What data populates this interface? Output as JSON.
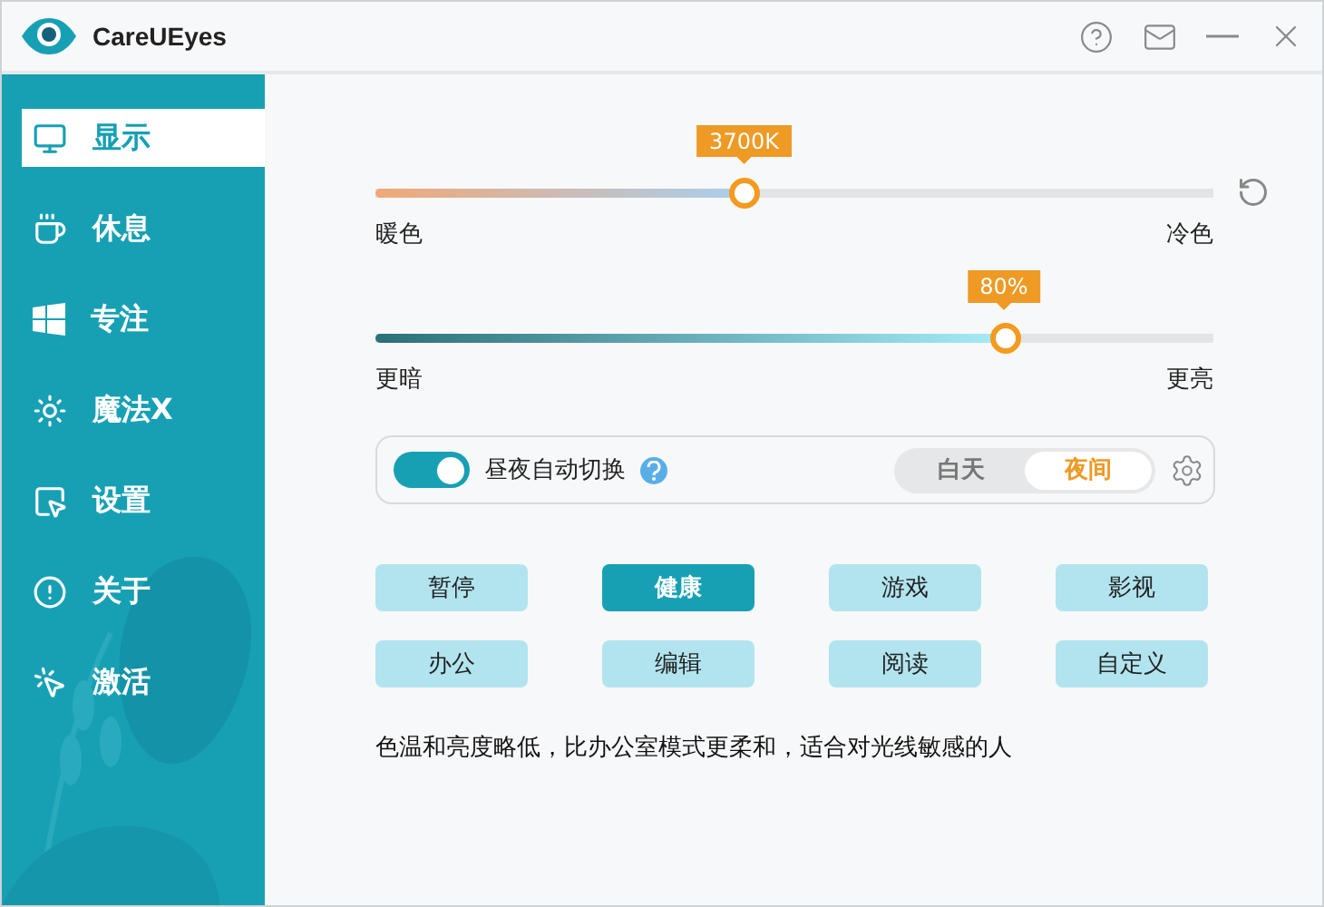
{
  "window": {
    "title": "CareUEyes"
  },
  "sidebar": {
    "items": [
      {
        "label": "显示",
        "kind": "monitor",
        "selected": true
      },
      {
        "label": "休息",
        "kind": "cup",
        "selected": false
      },
      {
        "label": "专注",
        "kind": "windows",
        "selected": false
      },
      {
        "label": "魔法X",
        "kind": "sun",
        "selected": false
      },
      {
        "label": "设置",
        "kind": "pointer",
        "selected": false
      },
      {
        "label": "关于",
        "kind": "alert",
        "selected": false
      },
      {
        "label": "激活",
        "kind": "click",
        "selected": false
      }
    ]
  },
  "sliders": [
    {
      "kind": "temperature",
      "level": 0.44,
      "reading": "3700K",
      "min_label": "暖色",
      "max_label": "冷色"
    },
    {
      "kind": "brightness",
      "level": 0.75,
      "reading": "80%",
      "min_label": "更暗",
      "max_label": "更亮"
    }
  ],
  "auto_switch": {
    "label": "昼夜自动切换",
    "on": true,
    "modes": [
      {
        "label": "白天",
        "selected": false
      },
      {
        "label": "夜间",
        "selected": true
      }
    ]
  },
  "presets": [
    {
      "label": "暂停",
      "selected": false
    },
    {
      "label": "健康",
      "selected": true
    },
    {
      "label": "游戏",
      "selected": false
    },
    {
      "label": "影视",
      "selected": false
    },
    {
      "label": "办公",
      "selected": false
    },
    {
      "label": "编辑",
      "selected": false
    },
    {
      "label": "阅读",
      "selected": false
    },
    {
      "label": "自定义",
      "selected": false
    }
  ],
  "description": "色温和亮度略低，比办公室模式更柔和，适合对光线敏感的人"
}
